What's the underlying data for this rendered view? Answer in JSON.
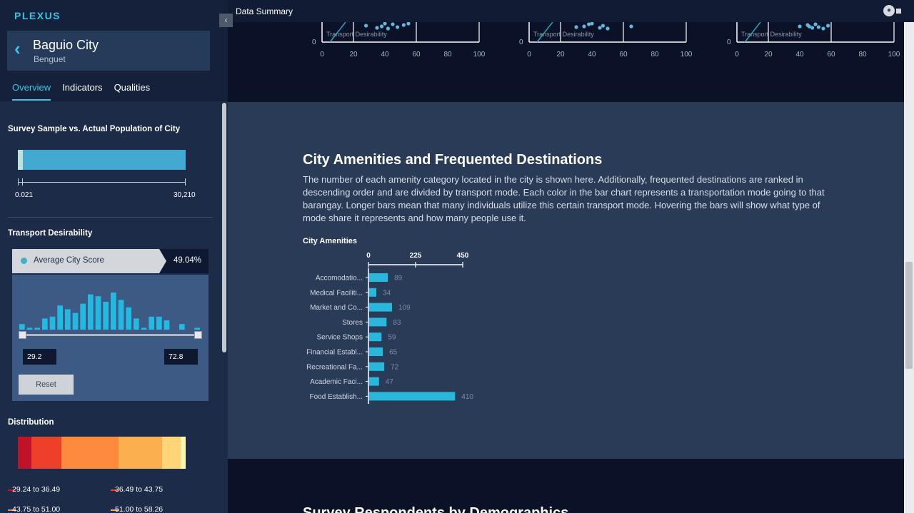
{
  "brand": "PLEXUS",
  "city": {
    "name": "Baguio City",
    "province": "Benguet"
  },
  "tabs": [
    {
      "label": "Overview",
      "active": true
    },
    {
      "label": "Indicators",
      "active": false
    },
    {
      "label": "Qualities",
      "active": false
    }
  ],
  "collapse_icon": "‹",
  "population": {
    "title": "Survey Sample vs. Actual Population of City",
    "sample_label": "0.021",
    "total_label": "30,210",
    "sample_fraction": 0.03
  },
  "transport": {
    "title": "Transport Desirability",
    "score_label": "Average City Score",
    "score_value": "49.04%",
    "histogram": [
      3,
      1,
      1,
      6,
      7,
      13,
      11,
      9,
      14,
      19,
      18,
      15,
      20,
      16,
      12,
      6,
      1,
      7,
      7,
      5,
      0,
      3,
      0,
      1
    ],
    "range_min": "29.2",
    "range_max": "72.8",
    "reset_label": "Reset"
  },
  "distribution": {
    "title": "Distribution",
    "segments": [
      {
        "color": "#c0132a",
        "share": 0.08
      },
      {
        "color": "#ee4029",
        "share": 0.18
      },
      {
        "color": "#fd8a3d",
        "share": 0.34
      },
      {
        "color": "#fcaf4f",
        "share": 0.26
      },
      {
        "color": "#fed677",
        "share": 0.11
      },
      {
        "color": "#fff6b4",
        "share": 0.03
      }
    ],
    "legend": [
      {
        "label": "29.24 to 36.49",
        "color": "#c0132a"
      },
      {
        "label": "36.49 to 43.75",
        "color": "#ee4029"
      },
      {
        "label": "43.75 to 51.00",
        "color": "#fd8a3d"
      },
      {
        "label": "51.00 to 58.26",
        "color": "#fcaf4f"
      }
    ]
  },
  "topbar": {
    "title": "Data Summary",
    "icon": "map-pin-icon"
  },
  "scatter_panels": [
    {
      "label": "Transport Desirability",
      "ticks": [
        "0",
        "20",
        "40",
        "60",
        "80",
        "100"
      ],
      "y0": "0",
      "points": [
        [
          28,
          5
        ],
        [
          35,
          8
        ],
        [
          38,
          6
        ],
        [
          42,
          9
        ],
        [
          45,
          3
        ],
        [
          48,
          7
        ],
        [
          52,
          4
        ],
        [
          55,
          2
        ],
        [
          40,
          2
        ]
      ]
    },
    {
      "label": "Transport Desirability",
      "ticks": [
        "0",
        "20",
        "40",
        "60",
        "80",
        "100"
      ],
      "y0": "0",
      "points": [
        [
          30,
          7
        ],
        [
          35,
          6
        ],
        [
          38,
          3
        ],
        [
          40,
          2
        ],
        [
          45,
          8
        ],
        [
          47,
          5
        ],
        [
          50,
          9
        ],
        [
          65,
          6
        ]
      ]
    },
    {
      "label": "Transport Desirability",
      "ticks": [
        "0",
        "20",
        "40",
        "60",
        "80",
        "100"
      ],
      "y0": "0",
      "points": [
        [
          40,
          6
        ],
        [
          45,
          4
        ],
        [
          48,
          8
        ],
        [
          50,
          3
        ],
        [
          52,
          7
        ],
        [
          55,
          9
        ],
        [
          58,
          5
        ],
        [
          46,
          6
        ]
      ]
    }
  ],
  "amenities": {
    "title": "City Amenities and Frequented Destinations",
    "description": "The number of each amenity category located in the city is shown here. Additionally, frequented destinations are ranked in descending order and are divided by transport mode. Each color in the bar chart represents a transportation mode going to that barangay. Longer bars mean that many individuals utilize this certain transport mode. Hovering the bars will show what type of mode share it represents and how many people use it.",
    "chart_title": "City Amenities"
  },
  "chart_data": {
    "type": "bar",
    "orientation": "horizontal",
    "title": "City Amenities",
    "categories": [
      "Accomodatio...",
      "Medical Faciliti...",
      "Market and Co...",
      "Stores",
      "Service Shops",
      "Financial Establ...",
      "Recreational Fa...",
      "Academic Faci...",
      "Food Establish..."
    ],
    "values": [
      89,
      34,
      109,
      83,
      59,
      65,
      72,
      47,
      410
    ],
    "value_labels": [
      "89",
      "34",
      "109",
      "83",
      "59",
      "65",
      "72",
      "47",
      "410"
    ],
    "xlim": [
      0,
      450
    ],
    "xticks": [
      "0",
      "225",
      "450"
    ],
    "bar_color": "#29b8dc"
  },
  "bottom_section": {
    "title": "Survey Respondents by Demographics"
  }
}
